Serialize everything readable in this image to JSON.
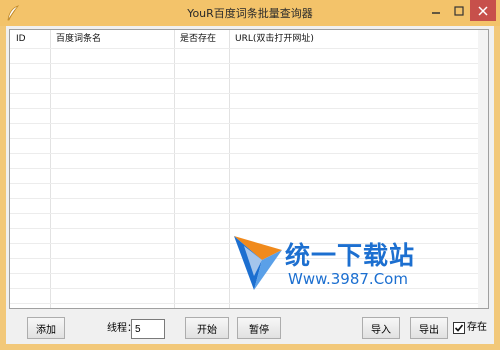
{
  "window": {
    "title": "YouR百度词条批量查询器"
  },
  "list": {
    "columns": [
      "ID",
      "百度词条名",
      "是否存在",
      "URL(双击打开网址)"
    ],
    "rows": []
  },
  "watermark": {
    "name": "统一下载站",
    "url": "Www.3987.Com"
  },
  "toolbar": {
    "add_label": "添加",
    "threads_label": "线程：",
    "threads_value": "5",
    "start_label": "开始",
    "pause_label": "暂停",
    "import_label": "导入",
    "export_label": "导出",
    "exists_label": "存在",
    "exists_checked": true
  },
  "colors": {
    "titlebar": "#f3c36a",
    "close_button": "#c7504b",
    "watermark_blue": "#1c6fd0",
    "watermark_orange": "#f08a1c"
  }
}
